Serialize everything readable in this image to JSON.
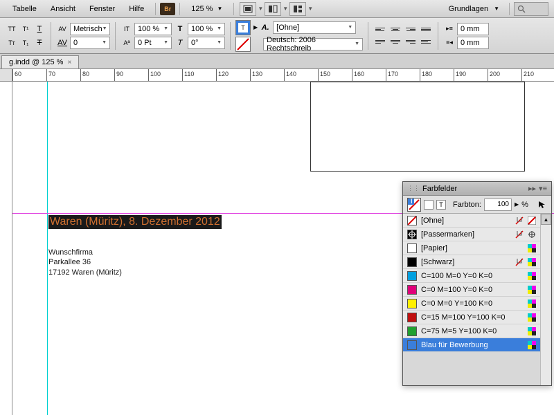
{
  "menubar": {
    "items": [
      "Tabelle",
      "Ansicht",
      "Fenster",
      "Hilfe"
    ],
    "bridge_label": "Br",
    "zoom": "125 %",
    "workspace": "Grundlagen"
  },
  "control_panel": {
    "metric_label": "Metrisch",
    "kerning": "0",
    "htrack": "100 %",
    "baseline": "0 Pt",
    "vtrack": "100 %",
    "skew": "0°",
    "style_none": "[Ohne]",
    "language": "Deutsch: 2006 Rechtschreib",
    "indent_left": "0 mm",
    "indent_right": "0 mm"
  },
  "tab": {
    "label": "g.indd @ 125 %"
  },
  "ruler": {
    "marks": [
      60,
      70,
      80,
      90,
      100,
      110,
      120,
      130,
      140,
      150,
      160,
      170,
      180,
      190,
      200,
      210
    ]
  },
  "document": {
    "selected_line": "Waren (Müritz), 8. Dezember 2012",
    "body": [
      "Wunschfirma",
      "Parkallee 36",
      "17192 Waren (Müritz)"
    ]
  },
  "swatches_panel": {
    "title": "Farbfelder",
    "tint_label": "Farbton:",
    "tint_value": "100",
    "tint_unit": "%",
    "items": [
      {
        "name": "[Ohne]",
        "color": "none",
        "locked": true,
        "type": "none"
      },
      {
        "name": "[Passermarken]",
        "color": "#000000",
        "locked": true,
        "type": "registration"
      },
      {
        "name": "[Papier]",
        "color": "#ffffff",
        "locked": false,
        "type": "process"
      },
      {
        "name": "[Schwarz]",
        "color": "#000000",
        "locked": true,
        "type": "process"
      },
      {
        "name": "C=100 M=0 Y=0 K=0",
        "color": "#00a0e0",
        "locked": false,
        "type": "process"
      },
      {
        "name": "C=0 M=100 Y=0 K=0",
        "color": "#e0007a",
        "locked": false,
        "type": "process"
      },
      {
        "name": "C=0 M=0 Y=100 K=0",
        "color": "#fff000",
        "locked": false,
        "type": "process"
      },
      {
        "name": "C=15 M=100 Y=100 K=0",
        "color": "#c01010",
        "locked": false,
        "type": "process"
      },
      {
        "name": "C=75 M=5 Y=100 K=0",
        "color": "#20a030",
        "locked": false,
        "type": "process"
      },
      {
        "name": "Blau für Bewerbung",
        "color": "#3a7edb",
        "locked": false,
        "type": "process",
        "selected": true
      }
    ]
  }
}
